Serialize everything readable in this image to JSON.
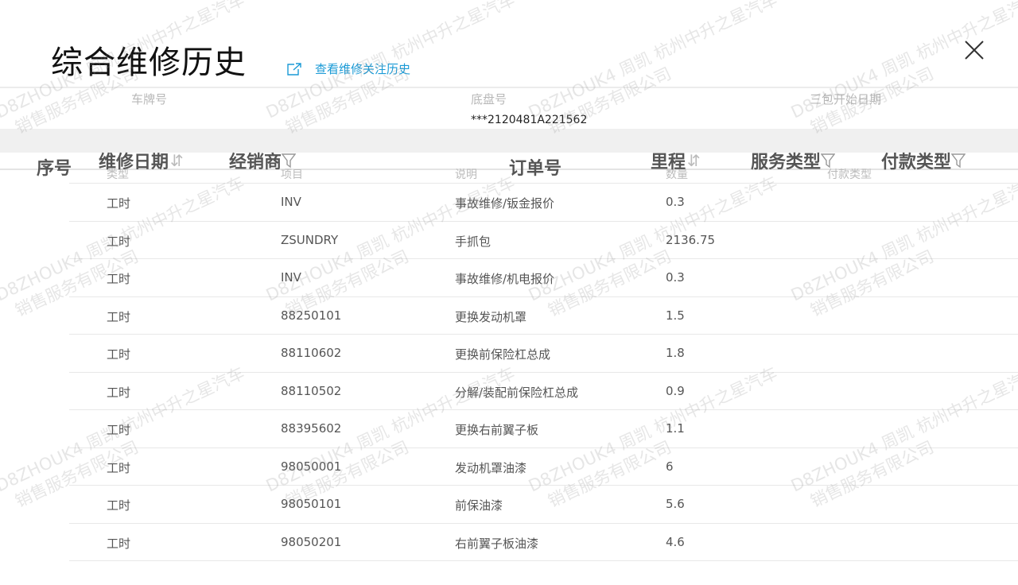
{
  "header": {
    "title": "综合维修历史",
    "follow_link_label": "查看维修关注历史"
  },
  "info": {
    "plate_label": "车牌号",
    "plate_value": "",
    "chassis_label": "底盘号",
    "chassis_value": "***2120481A221562",
    "warranty_label": "三包开始日期",
    "warranty_value": ""
  },
  "columns": [
    {
      "label": "序号",
      "icon": ""
    },
    {
      "label": "维修日期",
      "icon": "sort-icon"
    },
    {
      "label": "经销商",
      "icon": "filter-icon"
    },
    {
      "label": "订单号",
      "icon": ""
    },
    {
      "label": "里程",
      "icon": "sort-icon"
    },
    {
      "label": "服务类型",
      "icon": "filter-icon"
    },
    {
      "label": "付款类型",
      "icon": "filter-icon"
    }
  ],
  "sub_headers": [
    "类型",
    "项目",
    "说明",
    "数量",
    "付款类型"
  ],
  "rows": [
    {
      "type": "工时",
      "item": "INV",
      "desc": "事故维修/钣金报价",
      "qty": "0.3"
    },
    {
      "type": "工时",
      "item": "ZSUNDRY",
      "desc": "手抓包",
      "qty": "2136.75"
    },
    {
      "type": "工时",
      "item": "INV",
      "desc": "事故维修/机电报价",
      "qty": "0.3"
    },
    {
      "type": "工时",
      "item": "88250101",
      "desc": "更换发动机罩",
      "qty": "1.5"
    },
    {
      "type": "工时",
      "item": "88110602",
      "desc": "更换前保险杠总成",
      "qty": "1.8"
    },
    {
      "type": "工时",
      "item": "88110502",
      "desc": "分解/装配前保险杠总成",
      "qty": "0.9"
    },
    {
      "type": "工时",
      "item": "88395602",
      "desc": "更换右前翼子板",
      "qty": "1.1"
    },
    {
      "type": "工时",
      "item": "98050001",
      "desc": "发动机罩油漆",
      "qty": "6"
    },
    {
      "type": "工时",
      "item": "98050101",
      "desc": "前保油漆",
      "qty": "5.6"
    },
    {
      "type": "工时",
      "item": "98050201",
      "desc": "右前翼子板油漆",
      "qty": "4.6"
    }
  ],
  "watermark": {
    "line1": "D8ZHOUK4 周凯 杭州中升之星汽车",
    "line2": "销售服务有限公司"
  },
  "colors": {
    "accent": "#1a9ad6"
  }
}
